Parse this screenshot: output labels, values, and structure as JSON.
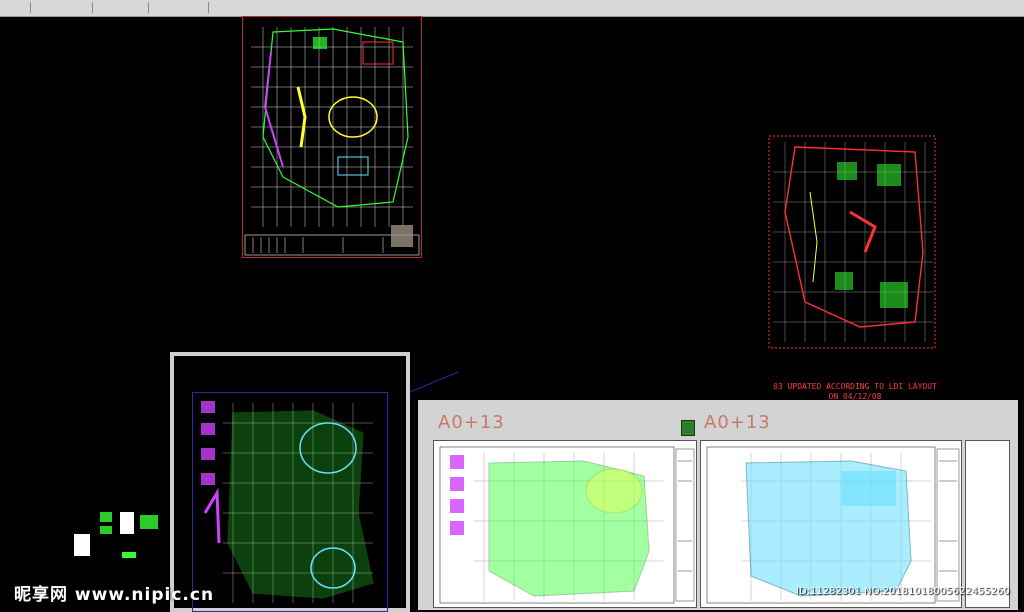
{
  "sheet_labels": {
    "left": "A0+13",
    "right": "A0+13"
  },
  "note": {
    "line1": "03 UPDATED ACCORDING TO LDI LAYOUT",
    "line2": "ON 04/12/08"
  },
  "watermark": {
    "site": "昵享网 www.nipic.cn",
    "id_text": "ID:11282301 NO:20181018005622455260"
  },
  "colors": {
    "background": "#000000",
    "grid": "#ffffff",
    "cad_green": "#33ff33",
    "cad_cyan": "#66e0ff",
    "cad_red": "#ff3030",
    "cad_magenta": "#d040ff",
    "cad_yellow": "#ffff33",
    "paper": "#ffffff",
    "panel_gray": "#d3d3d3"
  },
  "icons": {
    "pdf": "pdf-file-icon"
  }
}
